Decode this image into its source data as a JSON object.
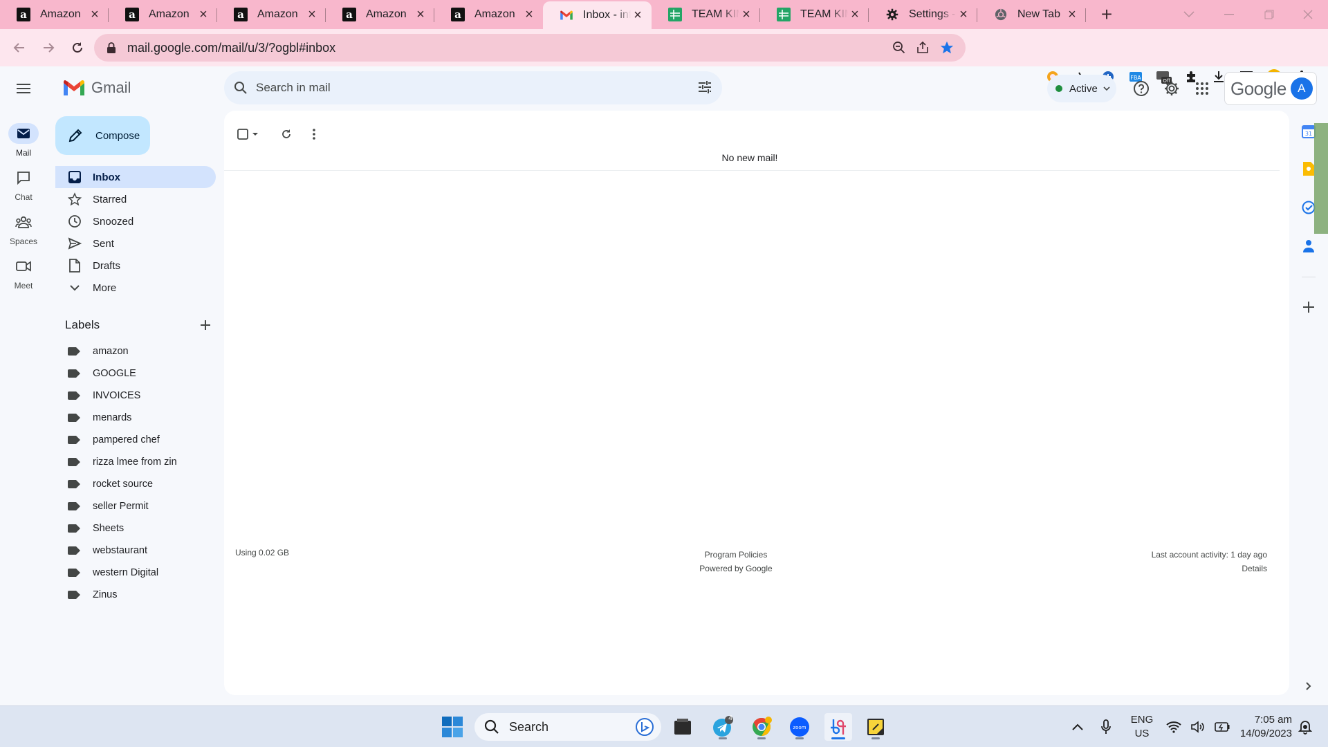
{
  "browser": {
    "tabs": [
      {
        "title": "Amazon",
        "icon": "amazon-icon",
        "active": false
      },
      {
        "title": "Amazon",
        "icon": "amazon-icon",
        "active": false
      },
      {
        "title": "Amazon",
        "icon": "amazon-icon",
        "active": false
      },
      {
        "title": "Amazon",
        "icon": "amazon-icon",
        "active": false
      },
      {
        "title": "Amazon",
        "icon": "amazon-icon",
        "active": false
      },
      {
        "title": "Inbox - info",
        "icon": "gmail-icon",
        "active": true
      },
      {
        "title": "TEAM KIM",
        "icon": "sheets-icon",
        "active": false
      },
      {
        "title": "TEAM KIM",
        "icon": "sheets-icon",
        "active": false
      },
      {
        "title": "Settings - R",
        "icon": "gear-icon",
        "active": false
      },
      {
        "title": "New Tab",
        "icon": "chrome-icon",
        "active": false
      }
    ],
    "url": "mail.google.com/mail/u/3/?ogbl#inbox",
    "tab_strip_color": "#f8b7cc",
    "toolbar_color": "#fde6ee"
  },
  "gmail": {
    "product_name": "Gmail",
    "search_placeholder": "Search in mail",
    "status": "Active",
    "account_initial": "A",
    "google_wordmark": "Google",
    "compose_label": "Compose",
    "rail": [
      {
        "label": "Mail",
        "icon": "mail-icon",
        "active": true
      },
      {
        "label": "Chat",
        "icon": "chat-icon",
        "active": false
      },
      {
        "label": "Spaces",
        "icon": "spaces-icon",
        "active": false
      },
      {
        "label": "Meet",
        "icon": "meet-icon",
        "active": false
      }
    ],
    "nav": [
      {
        "label": "Inbox",
        "icon": "inbox-icon",
        "active": true
      },
      {
        "label": "Starred",
        "icon": "star-icon",
        "active": false
      },
      {
        "label": "Snoozed",
        "icon": "clock-icon",
        "active": false
      },
      {
        "label": "Sent",
        "icon": "send-icon",
        "active": false
      },
      {
        "label": "Drafts",
        "icon": "draft-icon",
        "active": false
      },
      {
        "label": "More",
        "icon": "chevron-down-icon",
        "active": false
      }
    ],
    "labels_heading": "Labels",
    "labels": [
      "amazon",
      "GOOGLE",
      "INVOICES",
      "menards",
      "pampered chef",
      "rizza lmee from zin",
      "rocket source",
      "seller Permit",
      "Sheets",
      "webstaurant",
      "western Digital",
      "Zinus"
    ],
    "empty_message": "No new mail!",
    "footer": {
      "storage": "Using 0.02 GB",
      "program_policies": "Program Policies",
      "powered_by": "Powered by Google",
      "last_activity": "Last account activity: 1 day ago",
      "details": "Details"
    },
    "accent_color": "#c2e7ff",
    "selected_color": "#d3e3fd"
  },
  "taskbar": {
    "search_label": "Search",
    "telegram_badge": "4",
    "lang_line1": "ENG",
    "lang_line2": "US",
    "time": "7:05 am",
    "date": "14/09/2023"
  }
}
